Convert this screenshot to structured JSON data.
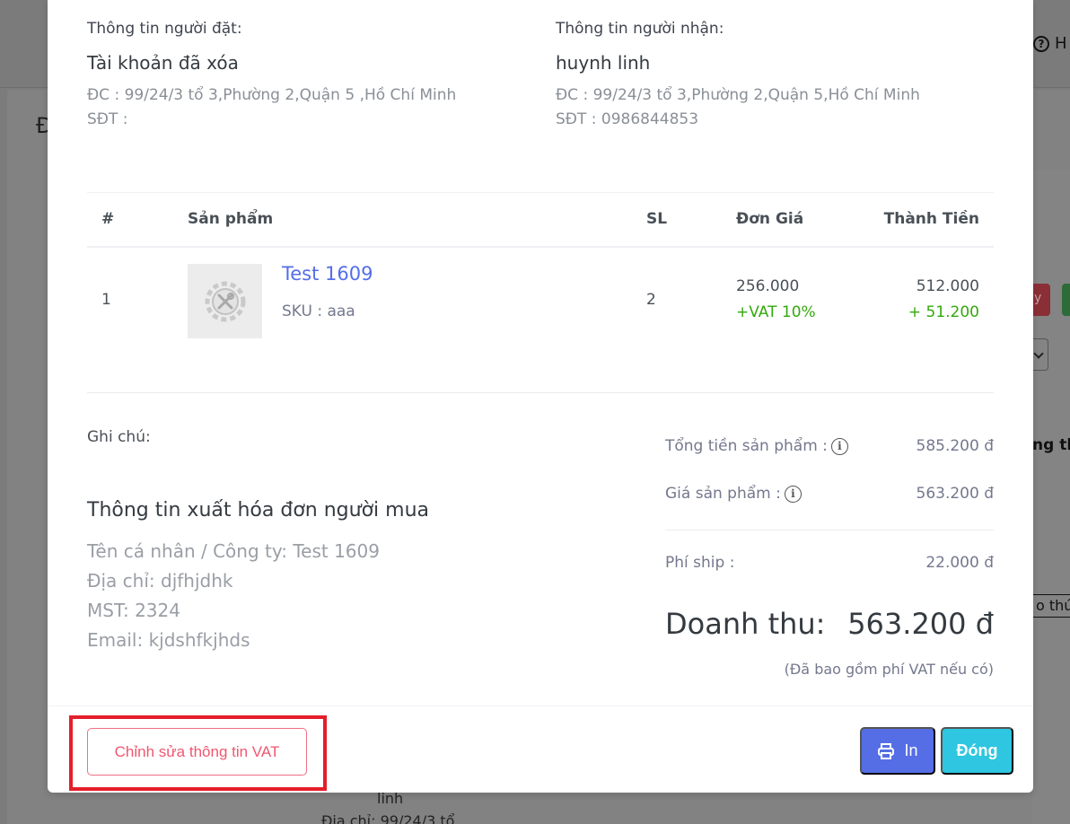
{
  "background": {
    "help_label": "H",
    "left_heading": "Đ",
    "red_button_fragment": "y",
    "bold_fragment": "ng th",
    "boxed_fragment": "o thứ",
    "bottom_line1": "linh",
    "bottom_line2": "Địa chỉ: 99/24/3 tổ"
  },
  "orderer": {
    "label": "Thông tin người đặt:",
    "name": "Tài khoản đã xóa",
    "address": "ĐC : 99/24/3 tổ 3,Phường 2,Quận 5 ,Hồ Chí Minh",
    "phone": "SĐT :"
  },
  "receiver": {
    "label": "Thông tin người nhận:",
    "name": "huynh linh",
    "address": "ĐC : 99/24/3 tổ 3,Phường 2,Quận 5,Hồ Chí Minh",
    "phone": "SĐT : 0986844853"
  },
  "table": {
    "headers": {
      "index": "#",
      "product": "Sản phẩm",
      "qty": "SL",
      "unit_price": "Đơn Giá",
      "total": "Thành Tiền"
    },
    "rows": [
      {
        "index": "1",
        "product_name": "Test 1609",
        "sku": "SKU : aaa",
        "qty": "2",
        "unit_price": "256.000",
        "vat": "+VAT 10%",
        "total": "512.000",
        "vat_amount": "+ 51.200"
      }
    ]
  },
  "note": {
    "label": "Ghi chú:"
  },
  "invoice": {
    "title": "Thông tin xuất hóa đơn người mua",
    "company": "Tên cá nhân / Công ty: Test 1609",
    "address": "Địa chỉ: djfhjdhk",
    "tax_code": "MST: 2324",
    "email": "Email: kjdshfkjhds"
  },
  "summary": {
    "products_total_label": "Tổng tiền sản phẩm :",
    "products_total_value": "585.200 đ",
    "product_price_label": "Giá sản phẩm :",
    "product_price_value": "563.200 đ",
    "shipping_label": "Phí ship :",
    "shipping_value": "22.000 đ",
    "revenue_label": "Doanh thu:",
    "revenue_value": "563.200 đ",
    "vat_note": "(Đã bao gồm phí VAT nếu có)",
    "info_glyph": "i"
  },
  "footer": {
    "edit_vat_label": "Chỉnh sửa thông tin VAT",
    "print_label": "In",
    "close_label": "Đóng"
  },
  "colors": {
    "primary": "#556ee6",
    "info": "#2ec6e0",
    "danger_outline": "#f06f84",
    "highlight_box": "#e41e2b",
    "success": "#34a90c"
  },
  "icons": {
    "printer": "printer-icon",
    "info": "info-circle-icon",
    "product_placeholder": "gear-tools-placeholder-icon"
  }
}
